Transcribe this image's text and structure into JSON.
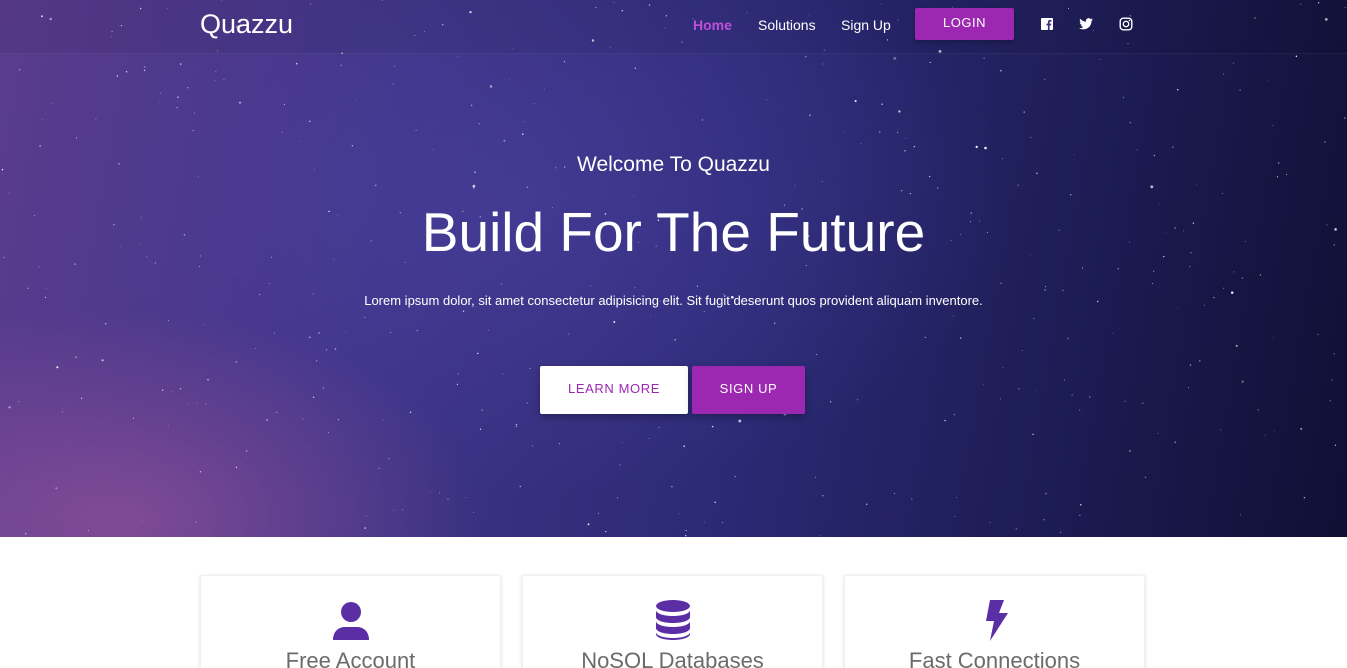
{
  "brand": "Quazzu",
  "nav": {
    "items": [
      {
        "label": "Home",
        "active": true
      },
      {
        "label": "Solutions",
        "active": false
      },
      {
        "label": "Sign Up",
        "active": false
      }
    ],
    "login_label": "LOGIN",
    "social_icons": [
      "facebook-icon",
      "twitter-icon",
      "instagram-icon"
    ]
  },
  "hero": {
    "welcome": "Welcome To Quazzu",
    "headline": "Build For The Future",
    "description": "Lorem ipsum dolor, sit amet consectetur adipisicing elit. Sit fugit deserunt quos provident aliquam inventore.",
    "learn_more_label": "LEARN MORE",
    "sign_up_label": "SIGN UP"
  },
  "features": [
    {
      "icon": "user-icon",
      "title": "Free Account"
    },
    {
      "icon": "database-icon",
      "title": "NoSQL Databases"
    },
    {
      "icon": "bolt-icon",
      "title": "Fast Connections"
    }
  ],
  "colors": {
    "accent": "#9c27b0",
    "nav_active": "#c04ed6",
    "feature_icon": "#5b2ea6",
    "feature_text": "#6b6b6b"
  }
}
